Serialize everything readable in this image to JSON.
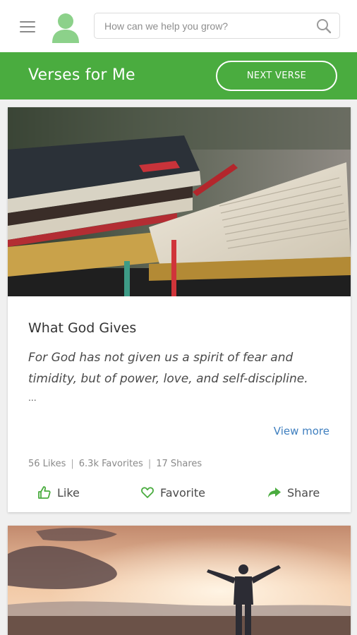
{
  "header": {
    "search_placeholder": "How can we help you grow?"
  },
  "banner": {
    "title": "Verses for Me",
    "next_button": "NEXT VERSE"
  },
  "colors": {
    "brand_green": "#4aac3f",
    "link_blue": "#3f7fbf"
  },
  "card": {
    "title": "What God Gives",
    "verse": "For God has not given us a spirit of fear and timidity, but of power, love, and self-discipline.",
    "ellipsis": "...",
    "view_more": "View more",
    "stats": {
      "likes": "56 Likes",
      "favorites": "6.3k Favorites",
      "shares": "17 Shares"
    },
    "actions": {
      "like": "Like",
      "favorite": "Favorite",
      "share": "Share"
    }
  },
  "icons": [
    "menu-icon",
    "avatar-icon",
    "search-icon",
    "thumbs-up-icon",
    "heart-icon",
    "share-arrow-icon"
  ]
}
